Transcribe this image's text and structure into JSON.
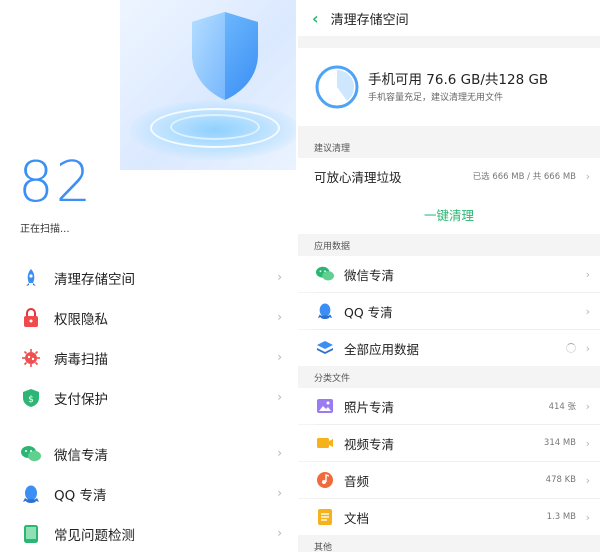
{
  "left": {
    "score": "82",
    "scanning_text": "正在扫描...",
    "menu_group1": [
      {
        "label": "清理存储空间",
        "icon": "rocket-icon"
      },
      {
        "label": "权限隐私",
        "icon": "lock-icon"
      },
      {
        "label": "病毒扫描",
        "icon": "virus-icon"
      },
      {
        "label": "支付保护",
        "icon": "payment-shield-icon"
      }
    ],
    "menu_group2": [
      {
        "label": "微信专清",
        "icon": "wechat-icon"
      },
      {
        "label": "QQ 专清",
        "icon": "qq-icon"
      },
      {
        "label": "常见问题检测",
        "icon": "phone-check-icon"
      }
    ],
    "chevron": "›"
  },
  "right": {
    "back_symbol": "‹",
    "title": "清理存储空间",
    "storage_main": "手机可用 76.6 GB/共128 GB",
    "storage_sub": "手机容量充足，建议清理无用文件",
    "used_fraction": 0.4,
    "section_suggest": "建议清理",
    "junk_label": "可放心清理垃圾",
    "junk_meta": "已选 666 MB / 共 666 MB",
    "oneclick_label": "一键清理",
    "section_app": "应用数据",
    "app_rows": [
      {
        "name": "微信专清",
        "meta": "",
        "icon": "wechat-icon"
      },
      {
        "name": "QQ 专清",
        "meta": "",
        "icon": "qq-icon"
      },
      {
        "name": "全部应用数据",
        "meta": "",
        "icon": "layers-icon"
      }
    ],
    "section_files": "分类文件",
    "file_rows": [
      {
        "name": "照片专清",
        "meta": "414 张",
        "icon": "photo-icon"
      },
      {
        "name": "视频专清",
        "meta": "314 MB",
        "icon": "video-icon"
      },
      {
        "name": "音频",
        "meta": "478 KB",
        "icon": "music-icon"
      },
      {
        "name": "文档",
        "meta": "1.3 MB",
        "icon": "document-icon"
      }
    ],
    "section_other": "其他",
    "chevron": "›"
  },
  "colors": {
    "accent_green": "#2bb673",
    "score_blue": "#3c8ff4"
  }
}
